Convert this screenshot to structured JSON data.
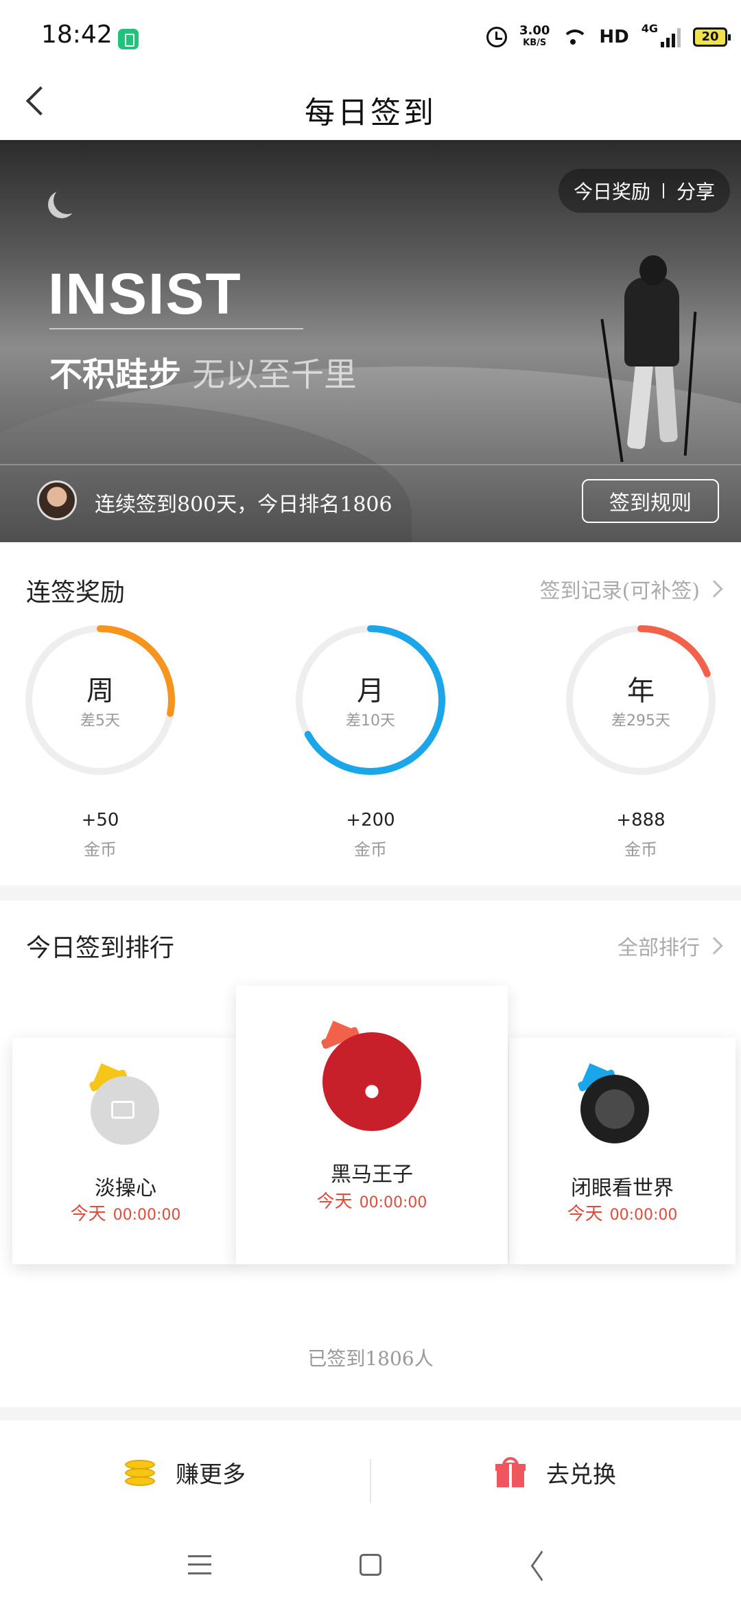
{
  "status_bar": {
    "time": "18:42",
    "net_speed_value": "3.00",
    "net_speed_unit": "KB/S",
    "hd_label": "HD",
    "network_label": "4G",
    "battery_level": "20"
  },
  "header": {
    "title": "每日签到"
  },
  "banner": {
    "today_reward_label": "今日奖励",
    "share_label": "分享",
    "headline": "INSIST",
    "slogan_main": "不积跬步",
    "slogan_sub": "无以至千里",
    "streak_text": "连续签到800天，今日排名1806",
    "rules_button": "签到规则"
  },
  "rewards": {
    "title": "连签奖励",
    "record_link": "签到记录(可补签)",
    "items": [
      {
        "label": "周",
        "remaining": "差5天",
        "value": "+50",
        "unit": "金币",
        "progress": 0.28,
        "color": "#f7941d"
      },
      {
        "label": "月",
        "remaining": "差10天",
        "value": "+200",
        "unit": "金币",
        "progress": 0.67,
        "color": "#1aa6e8"
      },
      {
        "label": "年",
        "remaining": "差295天",
        "value": "+888",
        "unit": "金币",
        "progress": 0.19,
        "color": "#f2614a"
      }
    ]
  },
  "ranking": {
    "title": "今日签到排行",
    "all_link": "全部排行",
    "users": [
      {
        "name": "淡操心",
        "day": "今天",
        "time": "00:00:00",
        "crown_color": "#f5c518"
      },
      {
        "name": "黑马王子",
        "day": "今天",
        "time": "00:00:00",
        "crown_color": "#f2614a"
      },
      {
        "name": "闭眼看世界",
        "day": "今天",
        "time": "00:00:00",
        "crown_color": "#1aa6e8"
      }
    ],
    "signed_count": "已签到1806人"
  },
  "actions": {
    "earn_more": "赚更多",
    "redeem": "去兑换"
  }
}
